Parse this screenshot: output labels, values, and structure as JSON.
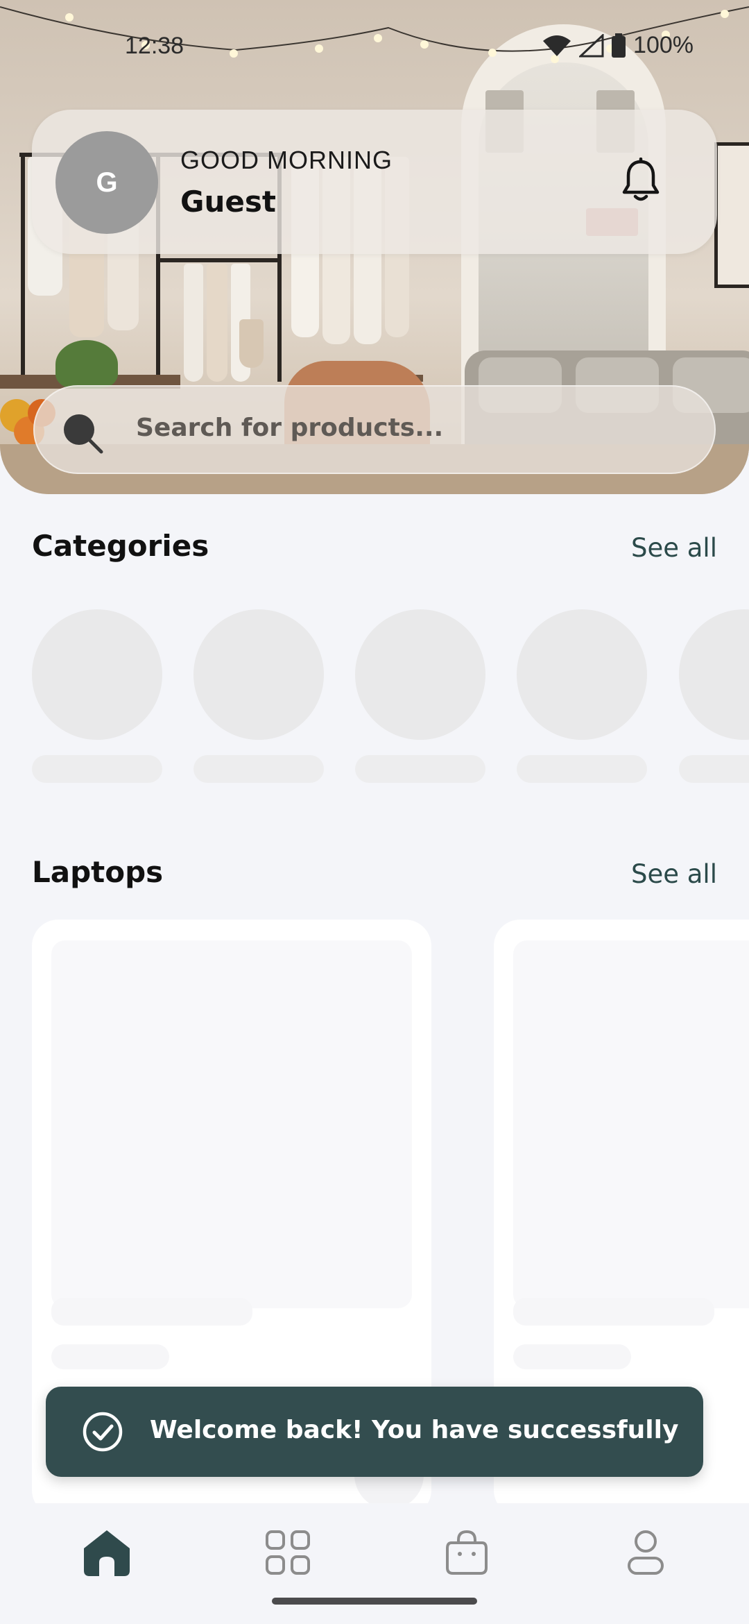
{
  "status_bar": {
    "time": "12:38",
    "battery": "100%",
    "icons": [
      "wifi-icon",
      "signal-icon",
      "battery-icon"
    ]
  },
  "header": {
    "avatar_initial": "G",
    "greeting": "GOOD MORNING",
    "user_name": "Guest",
    "notification_icon": "bell-icon"
  },
  "search": {
    "placeholder": "Search for products..."
  },
  "categories": {
    "title": "Categories",
    "see_all": "See all",
    "items_loading": 5
  },
  "laptops": {
    "title": "Laptops",
    "see_all": "See all",
    "cards_loading": 2
  },
  "toast": {
    "message": "Welcome back! You have successfully",
    "icon": "check-circle-icon"
  },
  "bottom_nav": {
    "items": [
      {
        "name": "home",
        "icon": "home-icon",
        "active": true
      },
      {
        "name": "categories",
        "icon": "grid-icon",
        "active": false
      },
      {
        "name": "cart",
        "icon": "bag-icon",
        "active": false
      },
      {
        "name": "profile",
        "icon": "user-icon",
        "active": false
      }
    ]
  },
  "colors": {
    "accent": "#334d4f",
    "background": "#f4f5f9",
    "skeleton": "#e9e9ea"
  }
}
